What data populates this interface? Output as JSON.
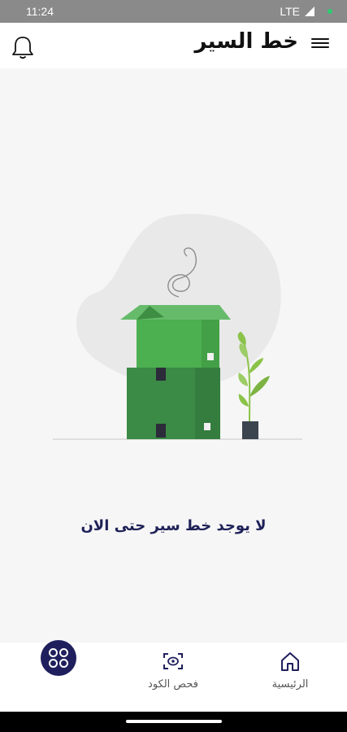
{
  "status_bar": {
    "time": "11:24",
    "network": "LTE"
  },
  "header": {
    "title": "خط السير",
    "menu_icon": "hamburger-menu-icon",
    "bell_icon": "notification-bell-icon"
  },
  "empty_state": {
    "message": "لا يوجد خط سير حتى الان"
  },
  "bottom_nav": {
    "home_label": "الرئيسية",
    "scan_label": "فحص الكود",
    "fab_icon": "grid-apps-icon"
  },
  "colors": {
    "primary": "#1f1f5e",
    "box_green": "#4caf50",
    "box_dark_green": "#3b8a45"
  }
}
